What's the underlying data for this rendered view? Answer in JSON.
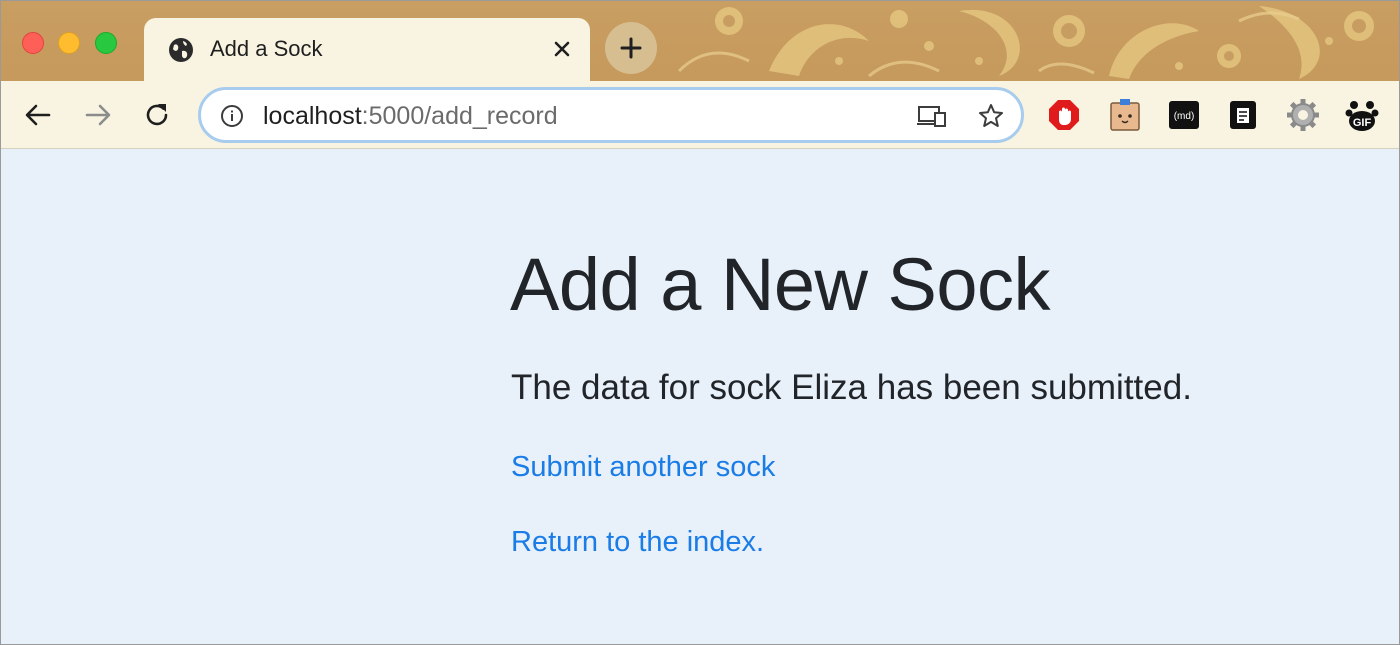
{
  "tab": {
    "title": "Add a Sock",
    "icon": "globe-icon"
  },
  "toolbar": {
    "url_host": "localhost",
    "url_path": ":5000/add_record",
    "extensions": [
      "adblock-icon",
      "extension-box-icon",
      "markdown-icon",
      "notes-icon",
      "gear-icon",
      "gif-icon"
    ]
  },
  "page": {
    "heading": "Add a New Sock",
    "message": "The data for sock Eliza has been submitted.",
    "links": [
      {
        "label": "Submit another sock"
      },
      {
        "label": "Return to the index."
      }
    ]
  },
  "colors": {
    "link": "#1a7ce6",
    "page_bg": "#e8f0f9",
    "text": "#212529",
    "theme_frame": "#c99e62"
  }
}
